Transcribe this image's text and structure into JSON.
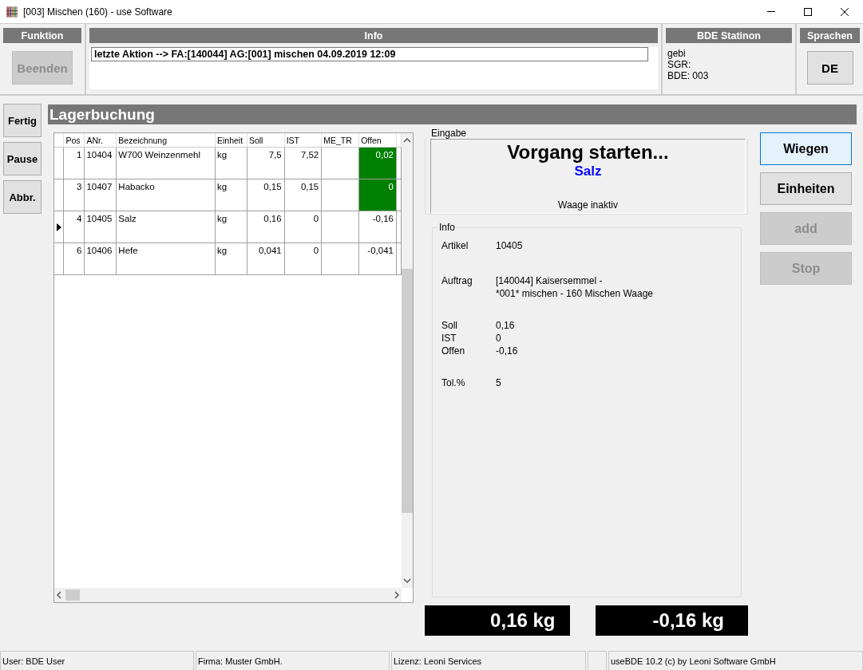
{
  "window": {
    "title": "[003] Mischen (160) - use Software"
  },
  "panels": {
    "funktion": {
      "header": "Funktion",
      "button": {
        "label": "Beenden",
        "disabled": true
      }
    },
    "info": {
      "header": "Info",
      "message": "letzte Aktion --> FA:[140044] AG:[001] mischen 04.09.2019 12:09"
    },
    "station": {
      "header": "BDE Statinon",
      "lines": [
        "gebi",
        "SGR:",
        "BDE: 003"
      ]
    },
    "language": {
      "header": "Sprachen",
      "button": "DE"
    }
  },
  "side_buttons": [
    "Fertig",
    "Pause",
    "Abbr."
  ],
  "section_title": "Lagerbuchung",
  "table": {
    "columns": [
      "Pos",
      "ANr.",
      "Bezeichnung",
      "Einheit",
      "Soll",
      "IST",
      "ME_TR",
      "Offen"
    ],
    "rows": [
      {
        "cells": [
          "1",
          "10404",
          "W700 Weinzenmehl",
          "kg",
          "7,5",
          "7,52",
          "",
          "0,02"
        ],
        "selected": false,
        "complete": true
      },
      {
        "cells": [
          "3",
          "10407",
          "Habacko",
          "kg",
          "0,15",
          "0,15",
          "",
          "0"
        ],
        "selected": false,
        "complete": true
      },
      {
        "cells": [
          "4",
          "10405",
          "Salz",
          "kg",
          "0,16",
          "0",
          "",
          "-0,16"
        ],
        "selected": true,
        "complete": false
      },
      {
        "cells": [
          "6",
          "10406",
          "Hefe",
          "kg",
          "0,041",
          "0",
          "",
          "-0,041"
        ],
        "selected": false,
        "complete": false
      }
    ]
  },
  "entry": {
    "legend": "Eingabe",
    "title": "Vorgang starten...",
    "article": "Salz",
    "status": "Waage inaktiv"
  },
  "info": {
    "legend": "Info",
    "groups": [
      [
        {
          "label": "Artikel",
          "lines": [
            "10405"
          ]
        }
      ],
      [
        {
          "label": "Auftrag",
          "lines": [
            "[140044] Kaisersemmel -",
            "*001* mischen - 160 Mischen Waage"
          ]
        }
      ],
      [
        {
          "label": "Soll",
          "lines": [
            "0,16"
          ]
        },
        {
          "label": "IST",
          "lines": [
            "0"
          ]
        },
        {
          "label": "Offen",
          "lines": [
            "-0,16"
          ]
        }
      ],
      [
        {
          "label": "Tol.%",
          "lines": [
            "5"
          ]
        }
      ]
    ]
  },
  "actions": [
    {
      "label": "Wiegen",
      "disabled": false,
      "focused": true
    },
    {
      "label": "Einheiten",
      "disabled": false,
      "focused": false
    },
    {
      "label": "add",
      "disabled": true,
      "focused": false
    },
    {
      "label": "Stop",
      "disabled": true,
      "focused": false
    }
  ],
  "readouts": [
    "0,16 kg",
    "-0,16 kg"
  ],
  "status_bar": {
    "user": "User: BDE User",
    "company": "Firma: Muster GmbH.",
    "license": "Lizenz: Leoni Services",
    "copyright": "useBDE 10.2 (c) by Leoni Software GmbH"
  }
}
